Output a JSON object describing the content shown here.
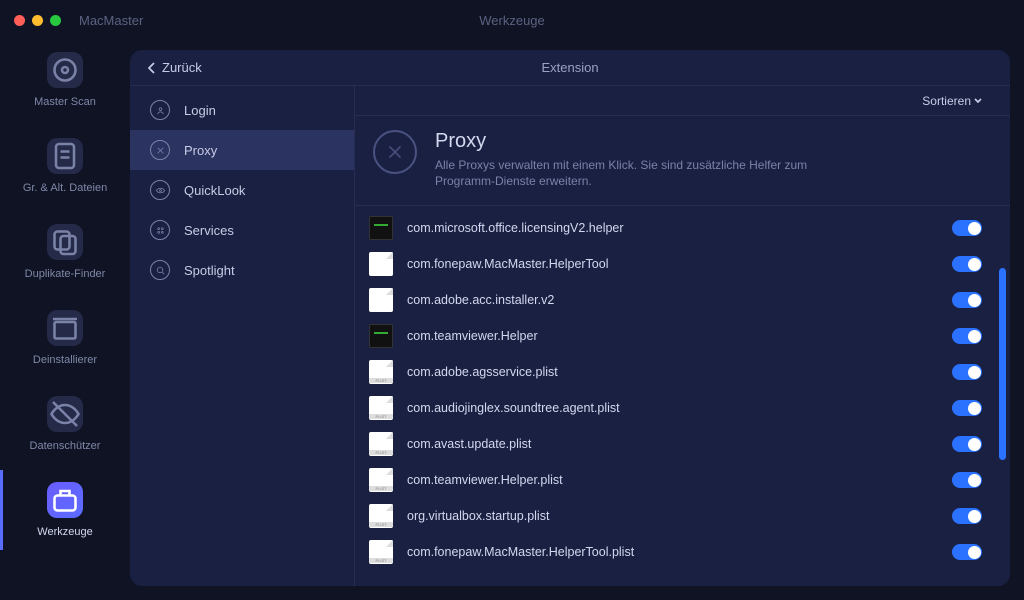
{
  "app_name": "MacMaster",
  "window_title": "Werkzeuge",
  "rail": [
    {
      "label": "Master Scan"
    },
    {
      "label": "Gr. & Alt. Dateien"
    },
    {
      "label": "Duplikate-Finder"
    },
    {
      "label": "Deinstallierer"
    },
    {
      "label": "Datenschützer"
    },
    {
      "label": "Werkzeuge"
    }
  ],
  "back_label": "Zurück",
  "panel_title": "Extension",
  "sort_label": "Sortieren",
  "categories": [
    {
      "label": "Login"
    },
    {
      "label": "Proxy"
    },
    {
      "label": "QuickLook"
    },
    {
      "label": "Services"
    },
    {
      "label": "Spotlight"
    }
  ],
  "hero": {
    "title": "Proxy",
    "desc": "Alle Proxys verwalten mit einem Klick. Sie sind zusätzliche Helfer zum Programm-Dienste erweitern."
  },
  "items": [
    {
      "icon": "exec",
      "name": "com.microsoft.office.licensingV2.helper"
    },
    {
      "icon": "blank",
      "name": "com.fonepaw.MacMaster.HelperTool"
    },
    {
      "icon": "blank",
      "name": "com.adobe.acc.installer.v2"
    },
    {
      "icon": "exec",
      "name": "com.teamviewer.Helper"
    },
    {
      "icon": "plist",
      "name": "com.adobe.agsservice.plist"
    },
    {
      "icon": "plist",
      "name": "com.audiojinglex.soundtree.agent.plist"
    },
    {
      "icon": "plist",
      "name": "com.avast.update.plist"
    },
    {
      "icon": "plist",
      "name": "com.teamviewer.Helper.plist"
    },
    {
      "icon": "plist",
      "name": "org.virtualbox.startup.plist"
    },
    {
      "icon": "plist",
      "name": "com.fonepaw.MacMaster.HelperTool.plist"
    }
  ]
}
